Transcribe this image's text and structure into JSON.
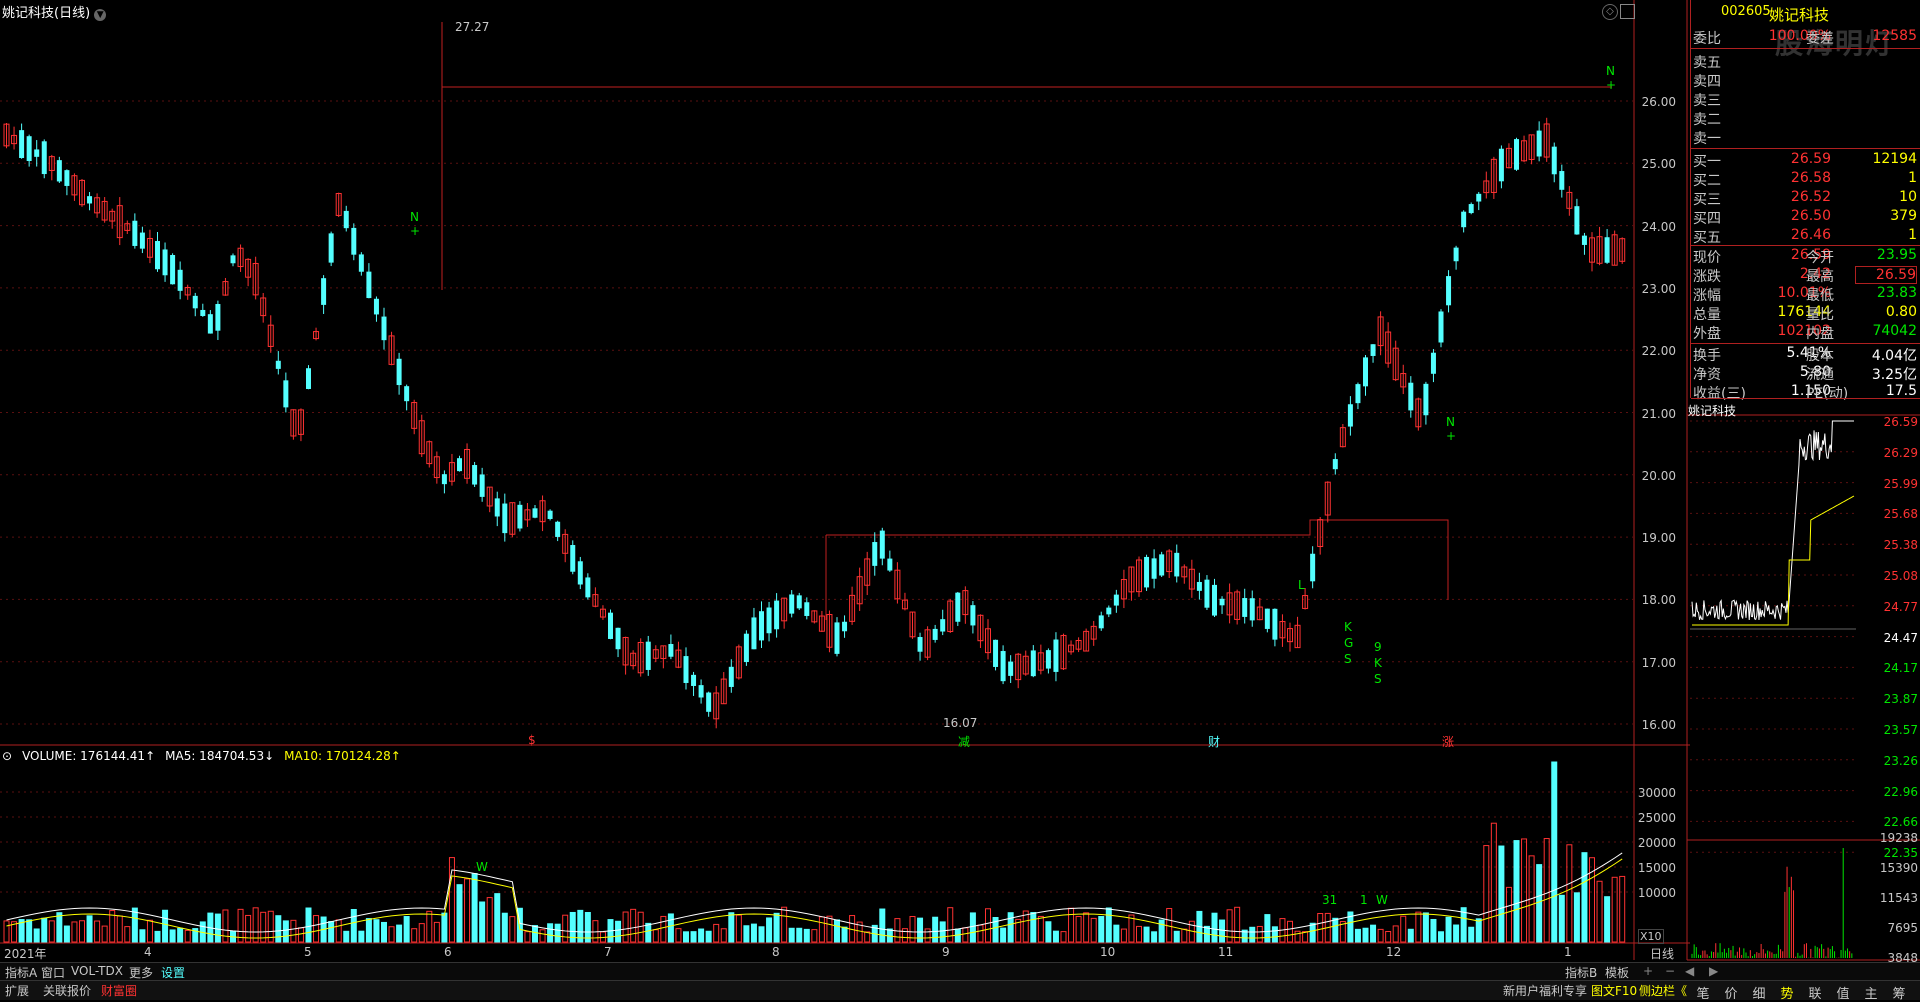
{
  "window": {
    "title": "姚记科技(日线)"
  },
  "volume_legend": {
    "volume": "VOLUME: 176144.41↑",
    "ma5": "MA5: 184704.53↓",
    "ma10": "MA10: 170124.28↑"
  },
  "colors": {
    "up": "#ff3232",
    "down": "#54ffff",
    "ma5": "#ffffff",
    "ma10": "#ffff00",
    "frame": "#b02020"
  },
  "price_axis": [
    "26.00",
    "25.00",
    "24.00",
    "23.00",
    "22.00",
    "21.00",
    "20.00",
    "19.00",
    "18.00",
    "17.00",
    "16.00"
  ],
  "volume_axis": [
    "30000",
    "25000",
    "20000",
    "15000",
    "10000"
  ],
  "x_axis": [
    "2021年",
    "4",
    "5",
    "6",
    "7",
    "8",
    "9",
    "10",
    "11",
    "12",
    "1"
  ],
  "markers": {
    "high": "27.27",
    "low": "16.07",
    "events": [
      "$",
      "减",
      "财",
      "涨"
    ],
    "signals": [
      "N",
      "+",
      "N",
      "+",
      "N",
      "+",
      "L",
      "K",
      "G",
      "S",
      "9",
      "K",
      "S",
      "W",
      "31",
      "1",
      "W"
    ],
    "x10": "X10"
  },
  "quote": {
    "code": "002605",
    "name": "姚记科技",
    "weibi_label": "委比",
    "weibi_value": "100.00%",
    "weicha_label": "委差",
    "weicha_value": "12585",
    "sell": [
      {
        "label": "卖五",
        "price": "",
        "vol": ""
      },
      {
        "label": "卖四",
        "price": "",
        "vol": ""
      },
      {
        "label": "卖三",
        "price": "",
        "vol": ""
      },
      {
        "label": "卖二",
        "price": "",
        "vol": ""
      },
      {
        "label": "卖一",
        "price": "",
        "vol": ""
      }
    ],
    "buy": [
      {
        "label": "买一",
        "price": "26.59",
        "vol": "12194"
      },
      {
        "label": "买二",
        "price": "26.58",
        "vol": "1"
      },
      {
        "label": "买三",
        "price": "26.52",
        "vol": "10"
      },
      {
        "label": "买四",
        "price": "26.50",
        "vol": "379"
      },
      {
        "label": "买五",
        "price": "26.46",
        "vol": "1"
      }
    ],
    "stats": [
      {
        "l1": "现价",
        "v1": "26.59",
        "l2": "今开",
        "v2": "23.95"
      },
      {
        "l1": "涨跌",
        "v1": "2.42",
        "l2": "最高",
        "v2": "26.59"
      },
      {
        "l1": "涨幅",
        "v1": "10.01%",
        "l2": "最低",
        "v2": "23.83"
      },
      {
        "l1": "总量",
        "v1": "176144",
        "l2": "量比",
        "v2": "0.80"
      },
      {
        "l1": "外盘",
        "v1": "102102",
        "l2": "内盘",
        "v2": "74042"
      }
    ],
    "stats2": [
      {
        "l1": "换手",
        "v1": "5.41%",
        "l2": "股本",
        "v2": "4.04亿"
      },
      {
        "l1": "净资",
        "v1": "5.80",
        "l2": "流通",
        "v2": "3.25亿"
      },
      {
        "l1": "收益(三)",
        "v1": "1.150",
        "l2": "PE(动)",
        "v2": "17.5"
      }
    ]
  },
  "intraday": {
    "title": "姚记科技",
    "price_axis": [
      "26.59",
      "26.29",
      "25.99",
      "25.68",
      "25.38",
      "25.08",
      "24.77",
      "24.47",
      "24.17",
      "23.87",
      "23.57",
      "23.26",
      "22.96",
      "22.66",
      "22.35"
    ],
    "vol_axis": [
      "19238",
      "15390",
      "11543",
      "7695",
      "3848"
    ]
  },
  "watermark": "股海明灯",
  "daily_label": "日线",
  "bottom_tabs": [
    "指标A",
    "窗口",
    "VOL-TDX",
    "更多",
    "设置"
  ],
  "bottom_right_tabs": [
    "指标B",
    "模板"
  ],
  "bottom_tabs2": [
    "扩展",
    "关联报价",
    "财富圈"
  ],
  "bottom_right2": [
    "新用户福利专享",
    "图文F10",
    "侧边栏《"
  ],
  "right_tabs": [
    "笔",
    "价",
    "细",
    "势",
    "联",
    "值",
    "主",
    "筹"
  ]
}
